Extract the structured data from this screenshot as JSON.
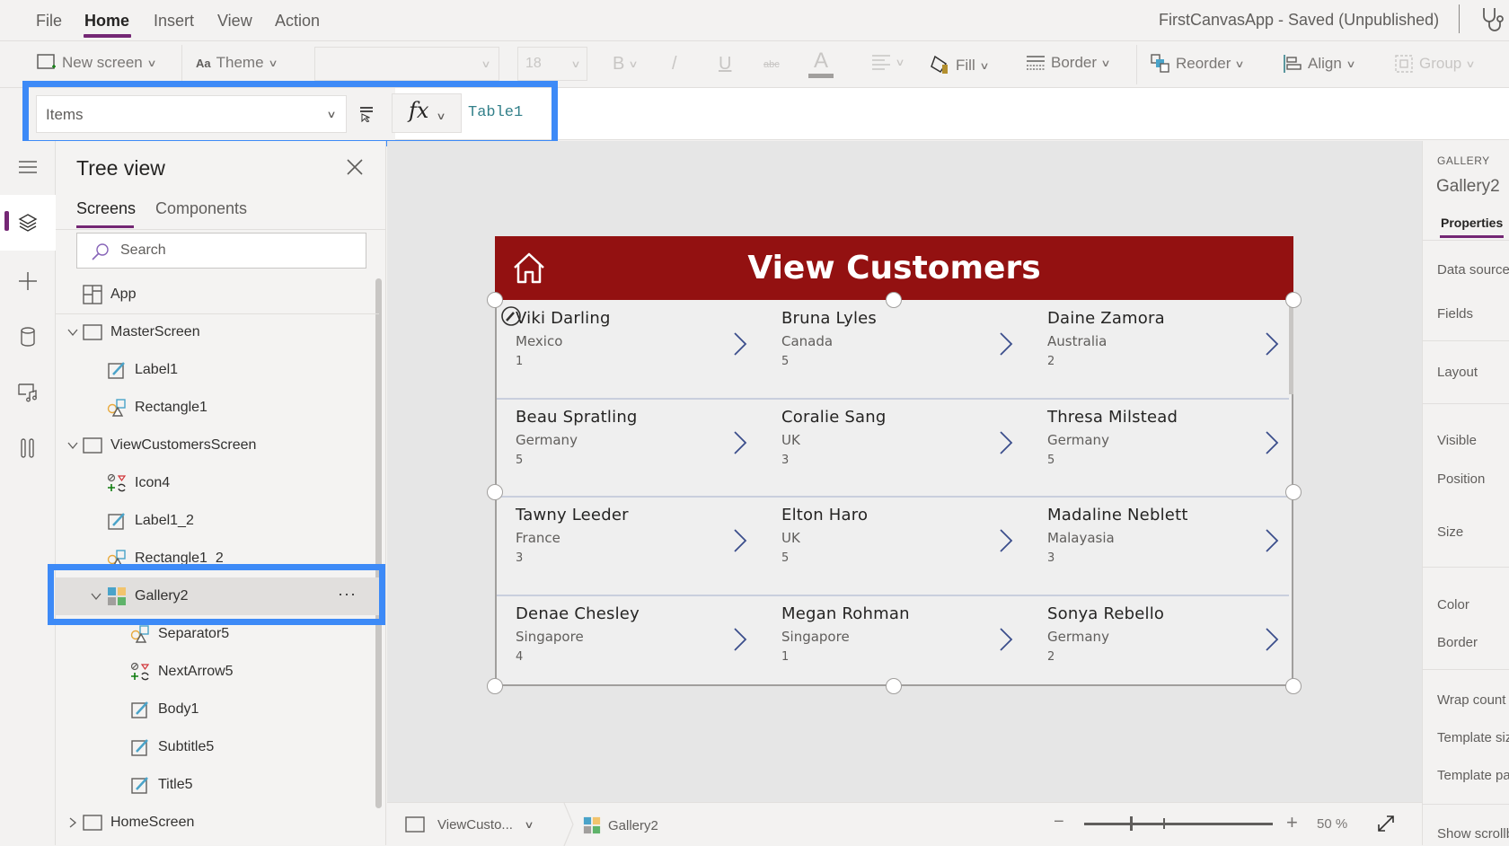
{
  "menubar": {
    "items": [
      {
        "label": "File",
        "active": false
      },
      {
        "label": "Home",
        "active": true
      },
      {
        "label": "Insert",
        "active": false
      },
      {
        "label": "View",
        "active": false
      },
      {
        "label": "Action",
        "active": false
      }
    ],
    "app_title": "FirstCanvasApp - Saved (Unpublished)",
    "app_checker_icon": "stethoscope-icon"
  },
  "toolbar": {
    "new_screen": "New screen",
    "theme": "Theme",
    "font_family_value": "",
    "font_size_value": "18",
    "bold": "B",
    "italic": "/",
    "underline": "U",
    "strikethrough": "abc",
    "font_color": "A",
    "fill": "Fill",
    "border": "Border",
    "reorder": "Reorder",
    "align": "Align",
    "group": "Group"
  },
  "formula_bar": {
    "property": "Items",
    "fx_label": "fx",
    "formula": "Table1"
  },
  "tree_view": {
    "title": "Tree view",
    "tabs": [
      {
        "label": "Screens",
        "active": true
      },
      {
        "label": "Components",
        "active": false
      }
    ],
    "search_placeholder": "Search",
    "items": [
      {
        "label": "App",
        "type": "app",
        "level": 0
      },
      {
        "label": "MasterScreen",
        "type": "screen",
        "level": 0,
        "expanded": true
      },
      {
        "label": "Label1",
        "type": "label",
        "level": 1
      },
      {
        "label": "Rectangle1",
        "type": "shape",
        "level": 1
      },
      {
        "label": "ViewCustomersScreen",
        "type": "screen",
        "level": 0,
        "expanded": true
      },
      {
        "label": "Icon4",
        "type": "icon",
        "level": 1
      },
      {
        "label": "Label1_2",
        "type": "label",
        "level": 1
      },
      {
        "label": "Rectangle1_2",
        "type": "shape",
        "level": 1
      },
      {
        "label": "Gallery2",
        "type": "gallery",
        "level": 1,
        "expanded": true,
        "selected": true
      },
      {
        "label": "Separator5",
        "type": "shape",
        "level": 2
      },
      {
        "label": "NextArrow5",
        "type": "icon",
        "level": 2
      },
      {
        "label": "Body1",
        "type": "label",
        "level": 2
      },
      {
        "label": "Subtitle5",
        "type": "label",
        "level": 2
      },
      {
        "label": "Title5",
        "type": "label",
        "level": 2
      },
      {
        "label": "HomeScreen",
        "type": "screen",
        "level": 0,
        "expanded": false
      }
    ],
    "more_label": "···"
  },
  "canvas": {
    "screen_title": "View Customers",
    "header_color": "#931111",
    "gallery_items": [
      {
        "title": "Viki Darling",
        "subtitle": "Mexico",
        "body": "1"
      },
      {
        "title": "Bruna Lyles",
        "subtitle": "Canada",
        "body": "5"
      },
      {
        "title": "Daine Zamora",
        "subtitle": "Australia",
        "body": "2"
      },
      {
        "title": "Beau Spratling",
        "subtitle": "Germany",
        "body": "5"
      },
      {
        "title": "Coralie Sang",
        "subtitle": "UK",
        "body": "3"
      },
      {
        "title": "Thresa Milstead",
        "subtitle": "Germany",
        "body": "5"
      },
      {
        "title": "Tawny Leeder",
        "subtitle": "France",
        "body": "3"
      },
      {
        "title": "Elton Haro",
        "subtitle": "UK",
        "body": "5"
      },
      {
        "title": "Madaline Neblett",
        "subtitle": "Malayasia",
        "body": "3"
      },
      {
        "title": "Denae Chesley",
        "subtitle": "Singapore",
        "body": "4"
      },
      {
        "title": "Megan Rohman",
        "subtitle": "Singapore",
        "body": "1"
      },
      {
        "title": "Sonya Rebello",
        "subtitle": "Germany",
        "body": "2"
      }
    ]
  },
  "statusbar": {
    "screen": "ViewCusto...",
    "control": "Gallery2",
    "zoom_minus": "−",
    "zoom_plus": "+",
    "zoom_value": "50 %",
    "zoom_percent": 50
  },
  "properties_panel": {
    "control_type": "GALLERY",
    "control_name": "Gallery2",
    "tab": "Properties",
    "labels": [
      "Data source",
      "Fields",
      "Layout",
      "Visible",
      "Position",
      "Size",
      "Color",
      "Border",
      "Wrap count",
      "Template size",
      "Template padding",
      "Show scrollbar"
    ]
  },
  "colors": {
    "accent": "#742774",
    "highlight": "#3d8af7",
    "arrow": "#3b4e8c",
    "formula_text": "#33808a"
  }
}
